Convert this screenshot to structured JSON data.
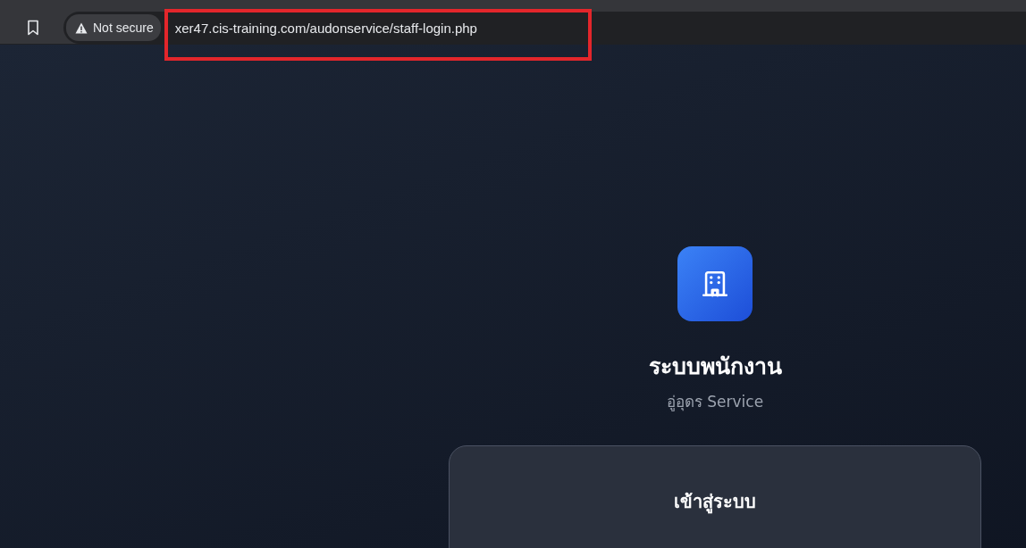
{
  "browser": {
    "security_label": "Not secure",
    "url": "xer47.cis-training.com/audonservice/staff-login.php"
  },
  "header": {
    "title": "ระบบพนักงาน",
    "subtitle": "อู่อุดร Service"
  },
  "login_card": {
    "title": "เข้าสู่ระบบ"
  }
}
